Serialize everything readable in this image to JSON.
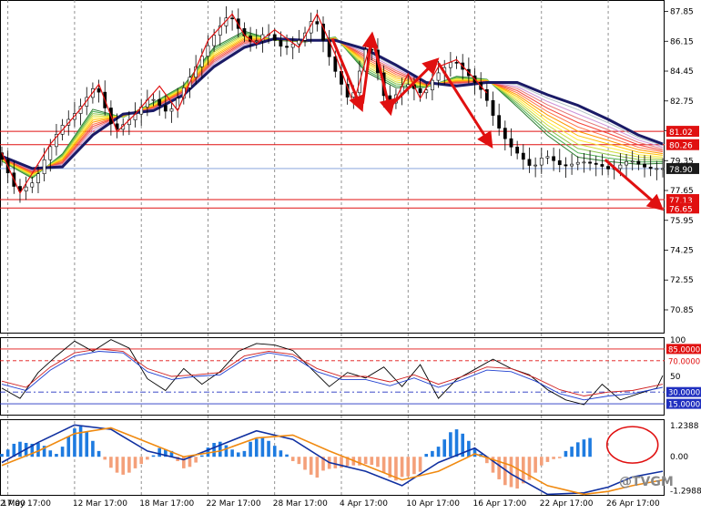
{
  "chart_data": [
    {
      "type": "line",
      "panel": "price",
      "ylim": [
        69.5,
        88.5
      ],
      "x_ticks": [
        "12 Mar 17:00",
        "18 Mar 17:00",
        "22 Mar 17:00",
        "28 Mar 17:00",
        "4 Apr 17:00",
        "10 Apr 17:00",
        "16 Apr 17:00",
        "22 Apr 17:00",
        "26 Apr 17:00",
        "2 May 17:00"
      ],
      "x_tick_first": "17:00",
      "y_ticks": [
        {
          "v": 87.85,
          "label": "87.85"
        },
        {
          "v": 86.15,
          "label": "86.15"
        },
        {
          "v": 84.45,
          "label": "84.45"
        },
        {
          "v": 82.75,
          "label": "82.75"
        },
        {
          "v": 81.05,
          "label": "81.05"
        },
        {
          "v": 79.35,
          "label": "79.35"
        },
        {
          "v": 77.65,
          "label": "77.65"
        },
        {
          "v": 75.95,
          "label": "75.95"
        },
        {
          "v": 74.25,
          "label": "74.25"
        },
        {
          "v": 72.55,
          "label": "72.55"
        },
        {
          "v": 70.85,
          "label": "70.85"
        }
      ],
      "levels": [
        {
          "v": 81.02,
          "label": "81.02",
          "color": "#e01010"
        },
        {
          "v": 80.26,
          "label": "80.26",
          "color": "#e01010"
        },
        {
          "v": 78.9,
          "label": "78.90",
          "color": "#7a9ad8",
          "current": true
        },
        {
          "v": 77.13,
          "label": "77.13",
          "color": "#e01010"
        },
        {
          "v": 76.65,
          "label": "76.65",
          "color": "#e01010"
        }
      ],
      "price": {
        "x": [
          0,
          3,
          6,
          8,
          10,
          13,
          16,
          19,
          22,
          25,
          28,
          31,
          34,
          36,
          38,
          40,
          42,
          44,
          47,
          50,
          52,
          55,
          58,
          61,
          64,
          67,
          70,
          72,
          75,
          78,
          80,
          82,
          84,
          86,
          88,
          90,
          93,
          96,
          99,
          101,
          104,
          107,
          109
        ],
        "y": [
          79.8,
          77.5,
          78.2,
          79.8,
          81.2,
          82.2,
          83.7,
          81.0,
          81.8,
          83.0,
          82.0,
          83.8,
          85.6,
          86.8,
          87.7,
          86.6,
          86.0,
          86.7,
          85.7,
          86.3,
          87.6,
          84.8,
          82.6,
          86.3,
          82.4,
          83.8,
          83.1,
          84.2,
          85.1,
          84.0,
          83.2,
          81.5,
          80.3,
          79.6,
          78.9,
          79.7,
          79.0,
          79.3,
          79.1,
          78.8,
          79.4,
          78.9,
          78.9
        ]
      },
      "ribbon_slow": {
        "x": [
          0,
          5,
          10,
          15,
          20,
          25,
          30,
          35,
          40,
          45,
          50,
          55,
          60,
          65,
          70,
          75,
          80,
          85,
          90,
          95,
          100,
          105,
          109
        ],
        "y": [
          79.6,
          78.9,
          79.0,
          80.8,
          82.0,
          82.2,
          83.1,
          84.7,
          85.8,
          86.3,
          86.2,
          86.2,
          85.7,
          84.8,
          83.8,
          83.6,
          83.8,
          83.8,
          83.1,
          82.5,
          81.7,
          80.8,
          80.3
        ]
      },
      "ribbon_fast": {
        "x": [
          0,
          5,
          10,
          15,
          20,
          25,
          30,
          35,
          40,
          45,
          50,
          55,
          60,
          65,
          70,
          75,
          80,
          85,
          90,
          95,
          100,
          105,
          109
        ],
        "y": [
          79.3,
          78.3,
          79.8,
          82.4,
          81.8,
          82.7,
          83.7,
          85.9,
          86.8,
          86.2,
          86.1,
          86.4,
          84.3,
          83.4,
          83.5,
          84.2,
          84.0,
          82.3,
          80.6,
          79.3,
          79.1,
          79.0,
          79.1
        ]
      },
      "zigzag": {
        "x": [
          0,
          3,
          8,
          13,
          16,
          19,
          22,
          26,
          29,
          34,
          38,
          40,
          42,
          45,
          49,
          52,
          55,
          58,
          61,
          64,
          67,
          69,
          72,
          75,
          78,
          80
        ],
        "y": [
          79.8,
          77.5,
          80.3,
          82.3,
          83.7,
          81.0,
          82.0,
          83.6,
          82.2,
          86.2,
          87.7,
          86.5,
          86.0,
          86.8,
          85.8,
          87.7,
          85.4,
          82.6,
          86.3,
          82.2,
          84.3,
          82.9,
          84.7,
          85.1,
          84.0,
          83.2
        ]
      },
      "arrows": [
        {
          "x1": 54.5,
          "y1": 86.3,
          "x2": 59.2,
          "y2": 82.4
        },
        {
          "x1": 59.5,
          "y1": 82.6,
          "x2": 61.0,
          "y2": 86.4
        },
        {
          "x1": 61.2,
          "y1": 86.3,
          "x2": 64.0,
          "y2": 82.2
        },
        {
          "x1": 64.5,
          "y1": 82.6,
          "x2": 71.5,
          "y2": 85.0
        },
        {
          "x1": 72.0,
          "y1": 84.9,
          "x2": 80.5,
          "y2": 80.3
        },
        {
          "x1": 99.5,
          "y1": 79.4,
          "x2": 108.5,
          "y2": 76.7
        }
      ]
    },
    {
      "type": "line",
      "panel": "oscillator",
      "ylim": [
        0,
        100
      ],
      "y_ticks": [
        {
          "v": 100,
          "label": "100"
        },
        {
          "v": 50,
          "label": "50"
        },
        {
          "v": 0,
          "label": "0"
        }
      ],
      "levels": [
        {
          "v": 85,
          "label": "85.0000",
          "color": "#e01010",
          "style": "solid",
          "tag": true
        },
        {
          "v": 70,
          "label": "70.0000",
          "color": "#e01010",
          "style": "dash",
          "tag": false
        },
        {
          "v": 30,
          "label": "30.0000",
          "color": "#2030c0",
          "style": "dashdot",
          "tag": true
        },
        {
          "v": 15,
          "label": "15.0000",
          "color": "#2030c0",
          "style": "solid",
          "tag": true
        }
      ],
      "series": [
        {
          "color": "#000000",
          "x": [
            0,
            3,
            6,
            9,
            12,
            15,
            18,
            21,
            24,
            27,
            30,
            33,
            36,
            39,
            42,
            45,
            48,
            51,
            54,
            57,
            60,
            63,
            66,
            69,
            72,
            75,
            78,
            81,
            84,
            87,
            90,
            93,
            96,
            99,
            102,
            105,
            108,
            109
          ],
          "y": [
            35,
            22,
            55,
            76,
            95,
            82,
            97,
            86,
            47,
            32,
            60,
            40,
            56,
            82,
            92,
            90,
            83,
            60,
            37,
            55,
            48,
            62,
            37,
            65,
            22,
            46,
            59,
            72,
            60,
            52,
            33,
            20,
            14,
            40,
            20,
            28,
            35,
            51
          ]
        },
        {
          "color": "#d02020",
          "x": [
            0,
            4,
            8,
            12,
            16,
            20,
            24,
            28,
            32,
            36,
            40,
            44,
            48,
            52,
            56,
            60,
            64,
            68,
            72,
            76,
            80,
            84,
            88,
            92,
            96,
            100,
            104,
            109
          ],
          "y": [
            44,
            36,
            62,
            80,
            85,
            82,
            60,
            50,
            52,
            55,
            76,
            82,
            78,
            60,
            50,
            50,
            43,
            52,
            40,
            50,
            62,
            60,
            48,
            33,
            25,
            30,
            32,
            40
          ]
        },
        {
          "color": "#2040d0",
          "x": [
            0,
            4,
            8,
            12,
            16,
            20,
            24,
            28,
            32,
            36,
            40,
            44,
            48,
            52,
            56,
            60,
            64,
            68,
            72,
            76,
            80,
            84,
            88,
            92,
            96,
            100,
            104,
            109
          ],
          "y": [
            40,
            32,
            58,
            76,
            82,
            80,
            56,
            46,
            50,
            52,
            72,
            80,
            75,
            56,
            46,
            46,
            38,
            48,
            36,
            46,
            58,
            56,
            44,
            28,
            20,
            25,
            28,
            36
          ]
        }
      ]
    },
    {
      "type": "bar",
      "panel": "macd",
      "ylim": [
        -1.35,
        1.3
      ],
      "y_ticks": [
        {
          "v": 1.2388,
          "label": "1.2388"
        },
        {
          "v": 0.0,
          "label": "0.00"
        },
        {
          "v": -1.2988,
          "label": "-1.2988"
        }
      ],
      "histogram": [
        0.1,
        0.25,
        0.45,
        0.52,
        0.48,
        0.45,
        0.48,
        0.38,
        0.22,
        0.1,
        0.35,
        0.7,
        0.98,
        1.05,
        0.88,
        0.55,
        0.2,
        -0.1,
        -0.38,
        -0.55,
        -0.62,
        -0.55,
        -0.4,
        -0.25,
        -0.1,
        0.05,
        0.3,
        0.25,
        0.2,
        -0.15,
        -0.4,
        -0.35,
        -0.2,
        0.05,
        0.32,
        0.48,
        0.52,
        0.4,
        0.25,
        0.15,
        0.2,
        0.52,
        0.62,
        0.65,
        0.55,
        0.38,
        0.22,
        0.08,
        -0.15,
        -0.25,
        -0.45,
        -0.62,
        -0.72,
        -0.48,
        -0.42,
        -0.4,
        -0.38,
        -0.32,
        -0.3,
        -0.3,
        -0.25,
        -0.28,
        -0.35,
        -0.55,
        -0.72,
        -0.82,
        -0.7,
        -0.68,
        -0.6,
        -0.52,
        0.1,
        0.2,
        0.35,
        0.6,
        0.85,
        0.95,
        0.8,
        0.55,
        0.3,
        0.1,
        -0.22,
        -0.55,
        -0.78,
        -0.98,
        -1.05,
        -1.1,
        -0.92,
        -0.8,
        -0.55,
        -0.3,
        -0.18,
        -0.08,
        -0.05,
        0.2,
        0.35,
        0.5,
        0.6,
        0.65
      ],
      "series": [
        {
          "color": "#1030a0",
          "x": [
            0,
            6,
            12,
            18,
            24,
            30,
            36,
            42,
            48,
            54,
            60,
            66,
            72,
            78,
            84,
            90,
            96,
            100,
            104,
            109
          ],
          "y": [
            -0.2,
            0.5,
            1.1,
            0.95,
            0.2,
            -0.1,
            0.4,
            0.9,
            0.6,
            -0.2,
            -0.5,
            -1.0,
            -0.2,
            0.3,
            -0.6,
            -1.3,
            -1.25,
            -1.05,
            -0.7,
            -0.5
          ]
        },
        {
          "color": "#f08a10",
          "x": [
            0,
            6,
            12,
            18,
            24,
            30,
            36,
            42,
            48,
            54,
            60,
            66,
            72,
            78,
            84,
            90,
            96,
            100,
            104,
            109
          ],
          "y": [
            -0.3,
            0.2,
            0.8,
            1.0,
            0.5,
            0.0,
            0.2,
            0.65,
            0.75,
            0.2,
            -0.3,
            -0.8,
            -0.5,
            0.1,
            -0.3,
            -1.0,
            -1.3,
            -1.2,
            -1.0,
            -0.8
          ]
        }
      ],
      "watermark": "@TVGM"
    }
  ]
}
